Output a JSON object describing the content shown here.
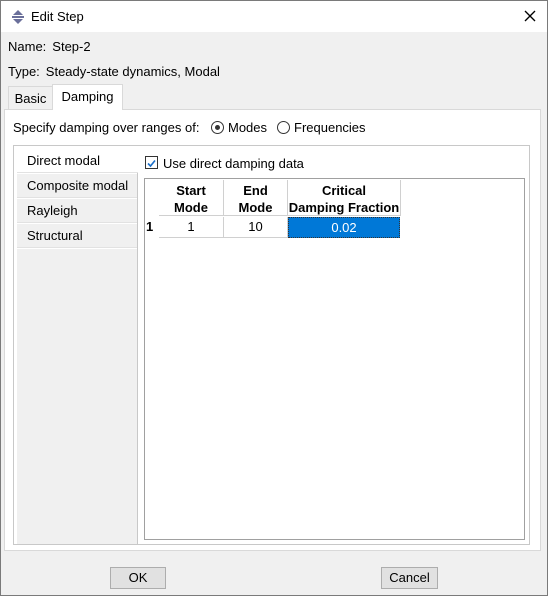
{
  "window": {
    "title": "Edit Step"
  },
  "info": {
    "name_label": "Name:",
    "name_value": "Step-2",
    "type_label": "Type:",
    "type_value": "Steady-state dynamics, Modal"
  },
  "tabs": [
    {
      "label": "Basic"
    },
    {
      "label": "Damping"
    }
  ],
  "damping": {
    "range_label": "Specify damping over ranges of:",
    "options": [
      {
        "label": "Modes",
        "selected": true
      },
      {
        "label": "Frequencies",
        "selected": false
      }
    ],
    "categories": [
      {
        "label": "Direct modal"
      },
      {
        "label": "Composite modal"
      },
      {
        "label": "Rayleigh"
      },
      {
        "label": "Structural"
      }
    ],
    "use_direct_label": "Use direct damping data",
    "use_direct_checked": true,
    "table": {
      "headers": [
        {
          "line1": "Start",
          "line2": "Mode"
        },
        {
          "line1": "End",
          "line2": "Mode"
        },
        {
          "line1": "Critical",
          "line2": "Damping Fraction"
        }
      ],
      "rows": [
        {
          "index": "1",
          "cells": [
            "1",
            "10",
            "0.02"
          ]
        }
      ]
    }
  },
  "buttons": {
    "ok": "OK",
    "cancel": "Cancel"
  }
}
